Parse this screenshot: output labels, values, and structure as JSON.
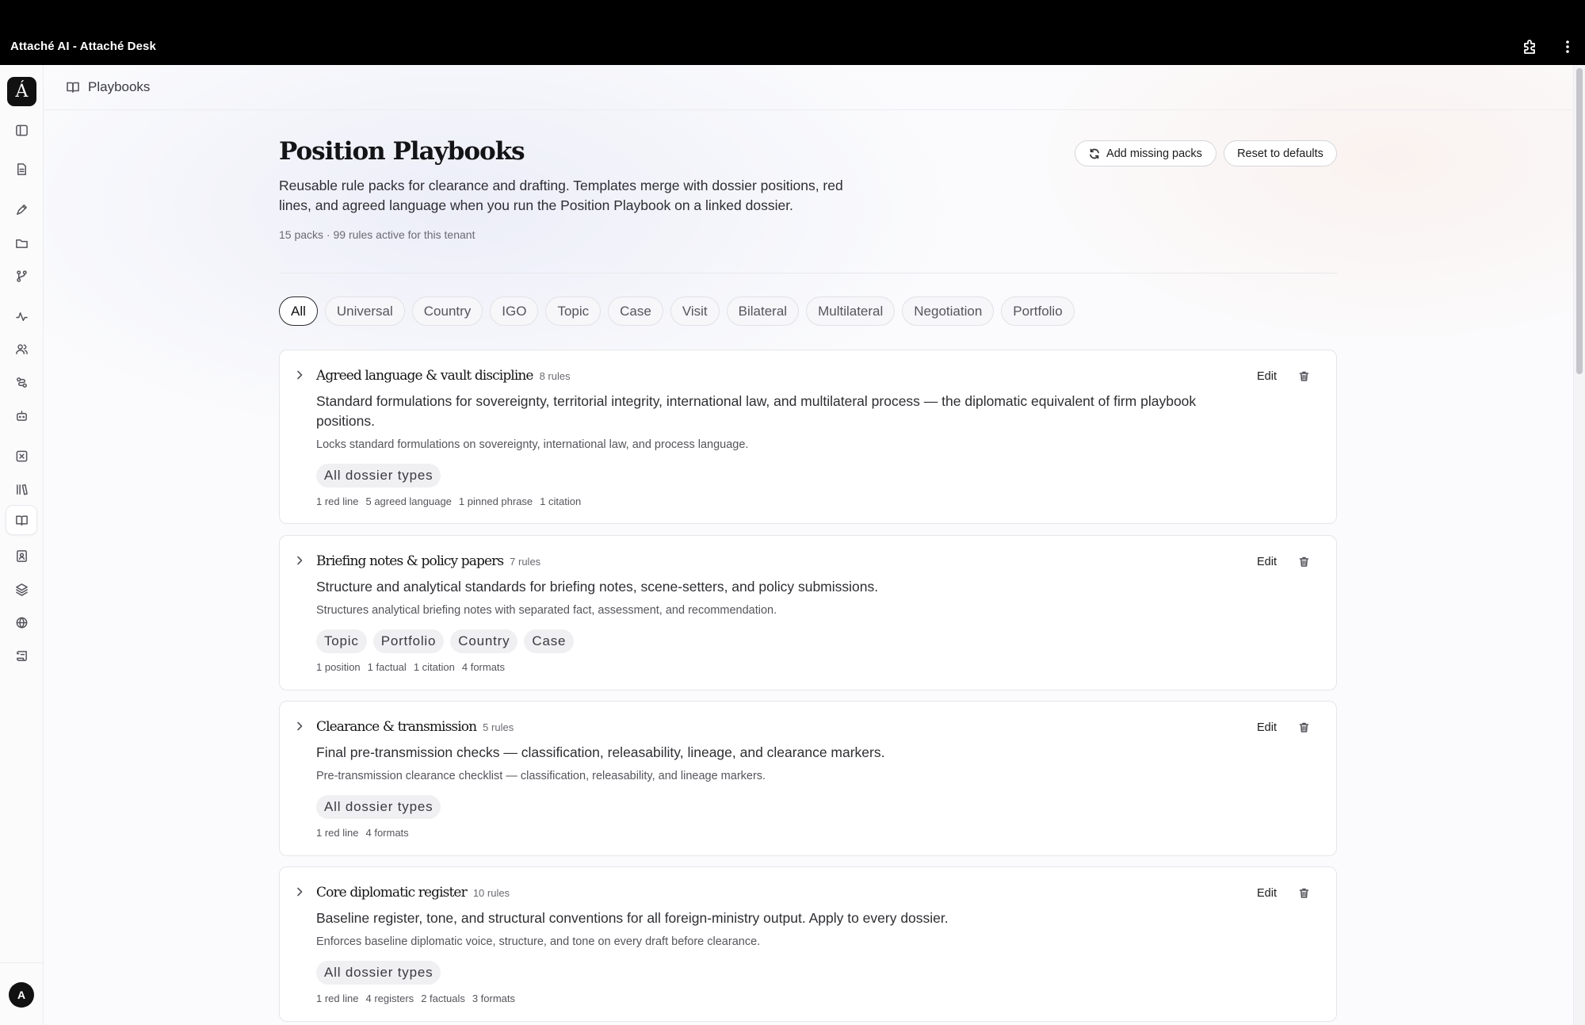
{
  "window": {
    "title": "Attaché AI - Attaché Desk"
  },
  "sidebar": {
    "logo": "Á",
    "items": [
      {
        "name": "sidebar-toggle-icon"
      },
      {
        "name": "document-icon"
      },
      {
        "name": "draft-pen-icon"
      },
      {
        "name": "folder-icon"
      },
      {
        "name": "branch-icon"
      },
      {
        "name": "activity-icon"
      },
      {
        "name": "people-icon"
      },
      {
        "name": "workflow-icon"
      },
      {
        "name": "bot-icon"
      },
      {
        "name": "close-square-icon"
      },
      {
        "name": "library-icon"
      },
      {
        "name": "book-open-icon",
        "active": true
      },
      {
        "name": "contact-book-icon"
      },
      {
        "name": "layers-icon"
      },
      {
        "name": "globe-icon"
      },
      {
        "name": "scroll-icon"
      }
    ],
    "avatar": "A"
  },
  "breadcrumb": {
    "label": "Playbooks",
    "icon": "book-open-icon"
  },
  "page": {
    "title": "Position Playbooks",
    "description": "Reusable rule packs for clearance and drafting. Templates merge with dossier positions, red lines, and agreed language when you run the Position Playbook on a linked dossier.",
    "stats": "15 packs · 99 rules active for this tenant"
  },
  "actions": {
    "add_missing": "Add missing packs",
    "reset": "Reset to defaults"
  },
  "filters": [
    "All",
    "Universal",
    "Country",
    "IGO",
    "Topic",
    "Case",
    "Visit",
    "Bilateral",
    "Multilateral",
    "Negotiation",
    "Portfolio"
  ],
  "active_filter": "All",
  "cards": [
    {
      "title": "Agreed language & vault discipline",
      "count": "8 rules",
      "description": "Standard formulations for sovereignty, territorial integrity, international law, and multilateral process — the diplomatic equivalent of firm playbook positions.",
      "summary": "Locks standard formulations on sovereignty, international law, and process language.",
      "tags": [
        "All dossier types"
      ],
      "meta": [
        "1 red line",
        "5 agreed language",
        "1 pinned phrase",
        "1 citation"
      ],
      "edit": "Edit"
    },
    {
      "title": "Briefing notes & policy papers",
      "count": "7 rules",
      "description": "Structure and analytical standards for briefing notes, scene-setters, and policy submissions.",
      "summary": "Structures analytical briefing notes with separated fact, assessment, and recommendation.",
      "tags": [
        "Topic",
        "Portfolio",
        "Country",
        "Case"
      ],
      "meta": [
        "1 position",
        "1 factual",
        "1 citation",
        "4 formats"
      ],
      "edit": "Edit"
    },
    {
      "title": "Clearance & transmission",
      "count": "5 rules",
      "description": "Final pre-transmission checks — classification, releasability, lineage, and clearance markers.",
      "summary": "Pre-transmission clearance checklist — classification, releasability, and lineage markers.",
      "tags": [
        "All dossier types"
      ],
      "meta": [
        "1 red line",
        "4 formats"
      ],
      "edit": "Edit"
    },
    {
      "title": "Core diplomatic register",
      "count": "10 rules",
      "description": "Baseline register, tone, and structural conventions for all foreign-ministry output. Apply to every dossier.",
      "summary": "Enforces baseline diplomatic voice, structure, and tone on every draft before clearance.",
      "tags": [
        "All dossier types"
      ],
      "meta": [
        "1 red line",
        "4 registers",
        "2 factuals",
        "3 formats"
      ],
      "edit": "Edit"
    }
  ]
}
